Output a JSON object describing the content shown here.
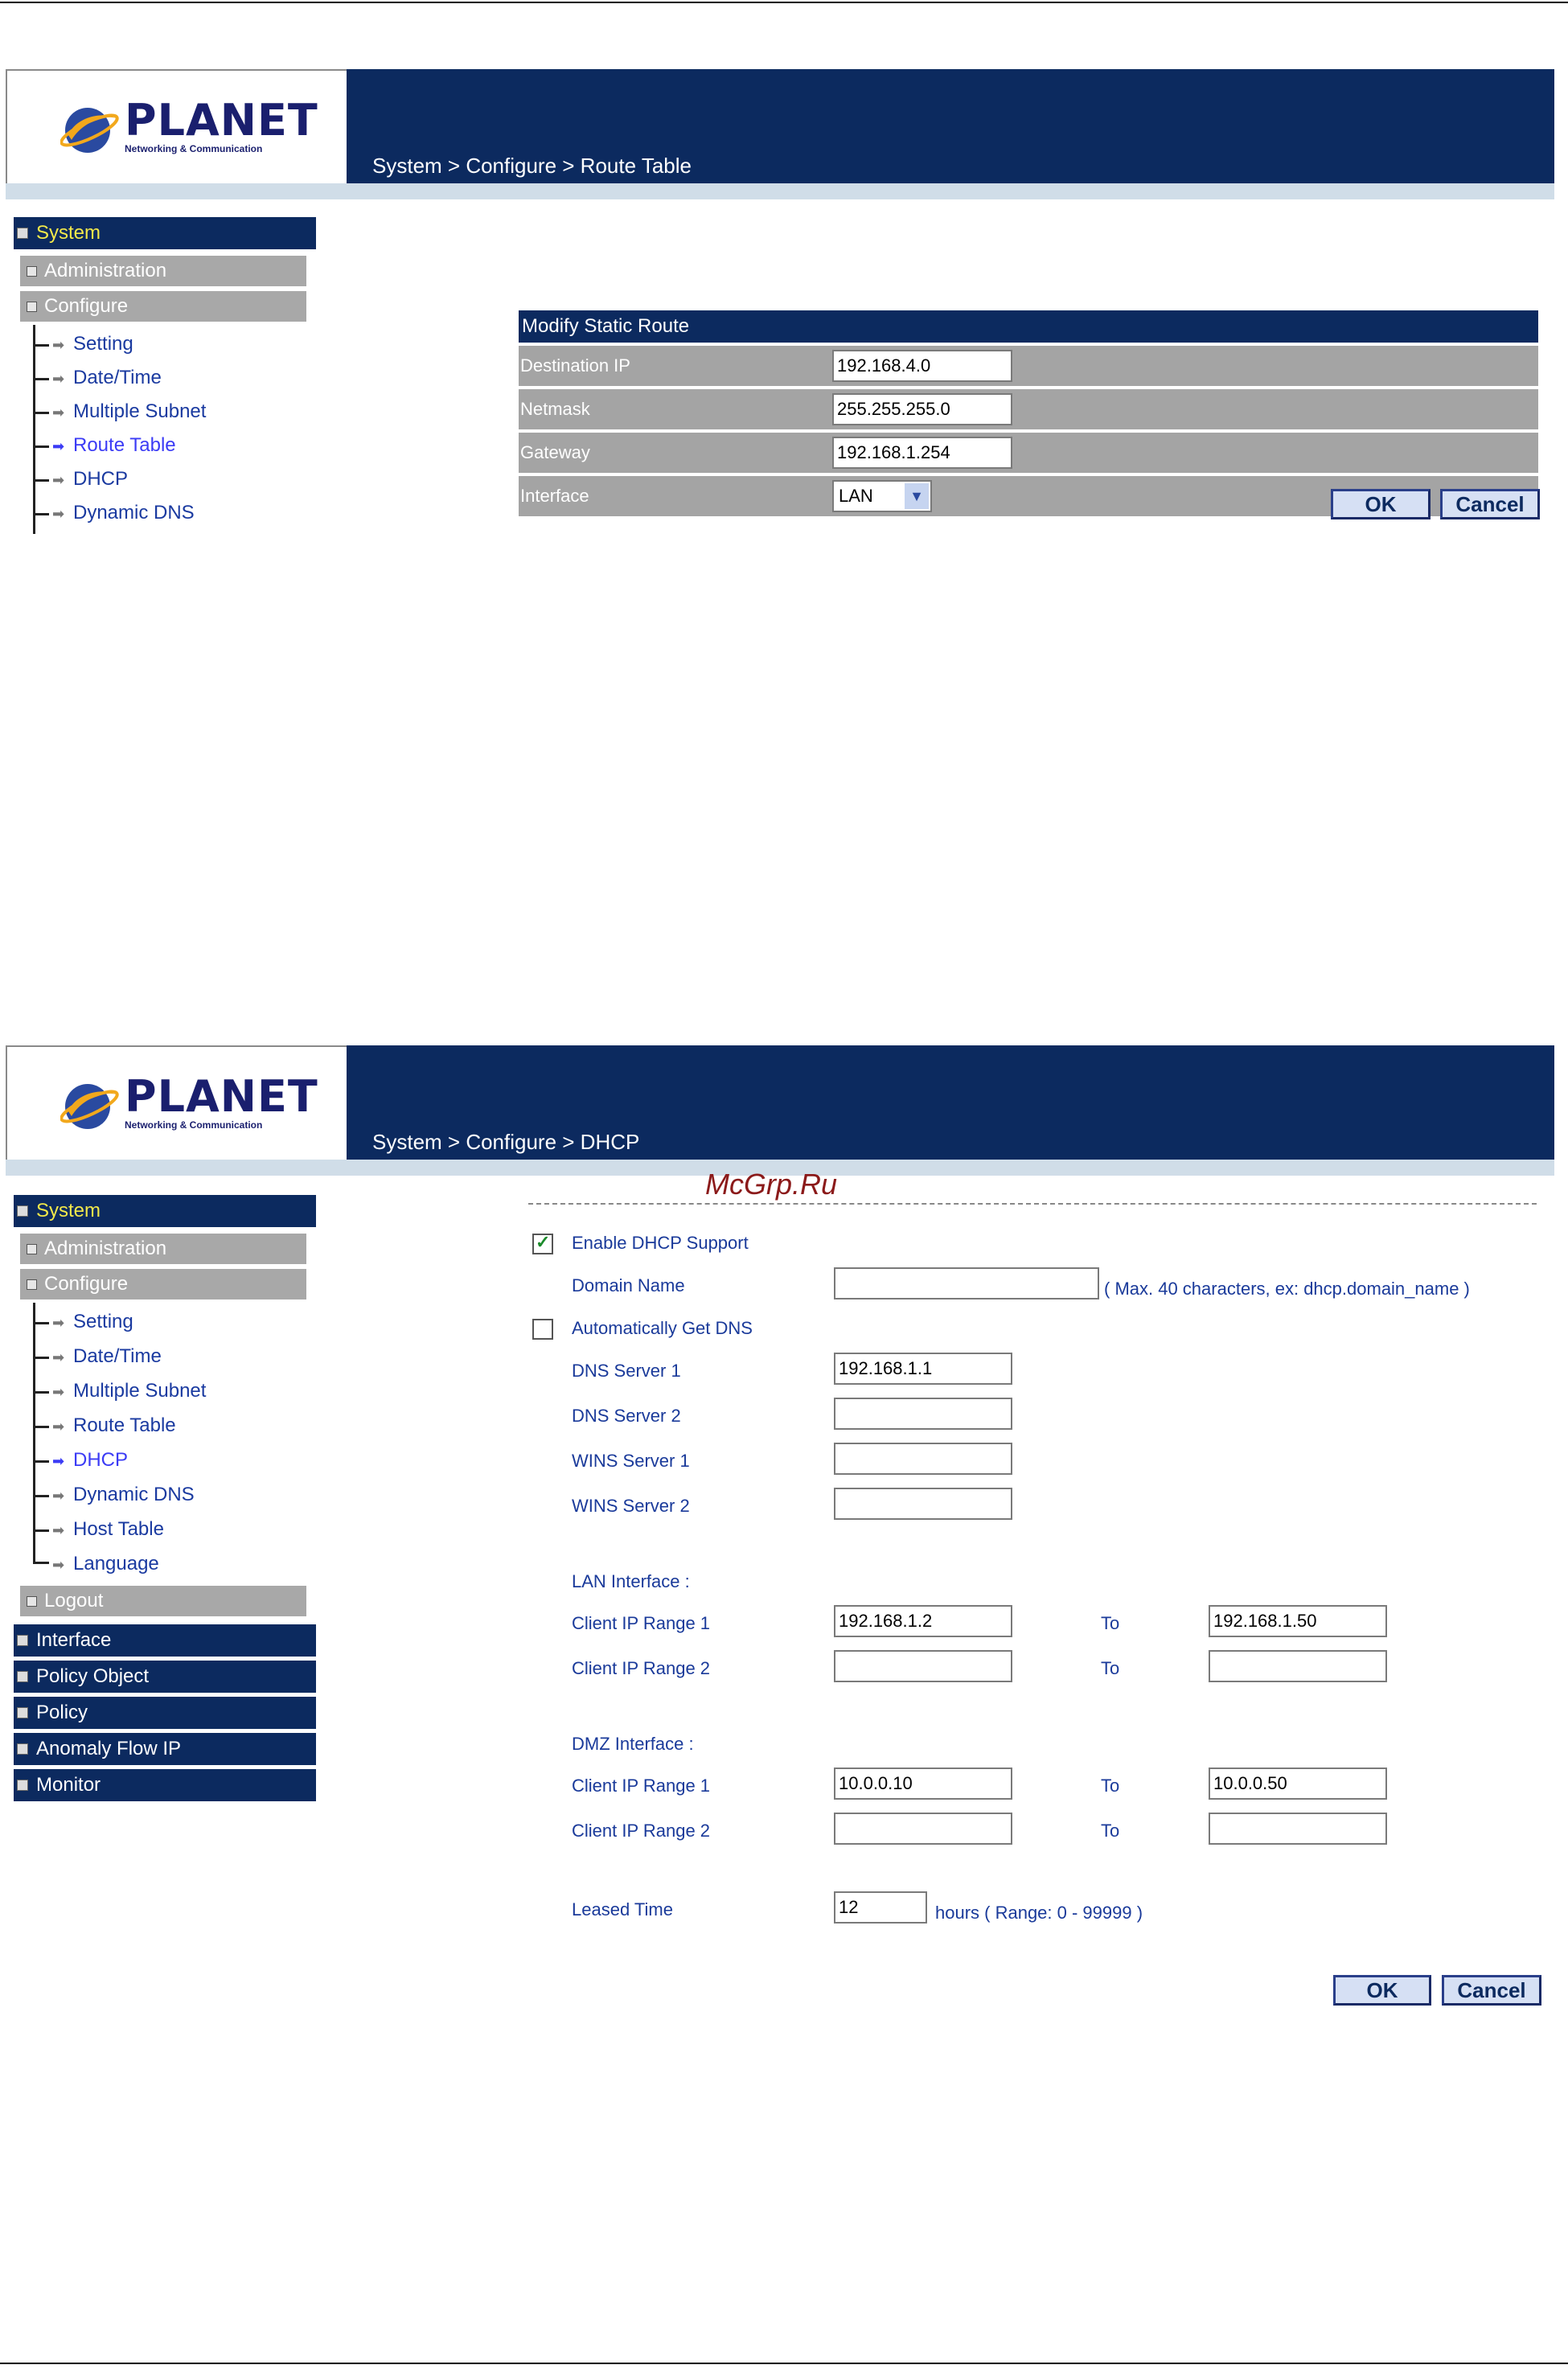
{
  "brand": {
    "name": "PLANET",
    "tagline": "Networking & Communication"
  },
  "screens": {
    "route": {
      "breadcrumb": "System > Configure > Route Table",
      "sidebar": {
        "root": "System",
        "administration": "Administration",
        "configure": "Configure",
        "items": [
          "Setting",
          "Date/Time",
          "Multiple Subnet",
          "Route Table",
          "DHCP",
          "Dynamic DNS"
        ]
      },
      "form": {
        "title": "Modify Static Route",
        "destination_label": "Destination IP",
        "destination_value": "192.168.4.0",
        "netmask_label": "Netmask",
        "netmask_value": "255.255.255.0",
        "gateway_label": "Gateway",
        "gateway_value": "192.168.1.254",
        "interface_label": "Interface",
        "interface_value": "LAN"
      },
      "ok": "OK",
      "cancel": "Cancel"
    },
    "dhcp": {
      "breadcrumb": "System > Configure > DHCP",
      "watermark": "McGrp.Ru",
      "sidebar": {
        "root": "System",
        "administration": "Administration",
        "configure": "Configure",
        "items": [
          "Setting",
          "Date/Time",
          "Multiple Subnet",
          "Route Table",
          "DHCP",
          "Dynamic DNS",
          "Host Table",
          "Language"
        ],
        "logout": "Logout",
        "sections": [
          "Interface",
          "Policy Object",
          "Policy",
          "Anomaly Flow IP",
          "Monitor"
        ]
      },
      "form": {
        "enable_label": "Enable DHCP Support",
        "enable_checked": true,
        "domain_label": "Domain Name",
        "domain_value": "",
        "domain_hint": "( Max. 40 characters, ex: dhcp.domain_name )",
        "auto_dns_label": "Automatically Get DNS",
        "auto_dns_checked": false,
        "dns1_label": "DNS Server 1",
        "dns1_value": "192.168.1.1",
        "dns2_label": "DNS Server 2",
        "dns2_value": "",
        "wins1_label": "WINS Server 1",
        "wins1_value": "",
        "wins2_label": "WINS Server 2",
        "wins2_value": "",
        "lan_heading": "LAN Interface :",
        "lan_range1_label": "Client IP Range 1",
        "lan_range1_from": "192.168.1.2",
        "lan_range1_to": "192.168.1.50",
        "lan_range2_label": "Client IP Range 2",
        "lan_range2_from": "",
        "lan_range2_to": "",
        "dmz_heading": "DMZ Interface :",
        "dmz_range1_label": "Client IP Range 1",
        "dmz_range1_from": "10.0.0.10",
        "dmz_range1_to": "10.0.0.50",
        "dmz_range2_label": "Client IP Range 2",
        "dmz_range2_from": "",
        "dmz_range2_to": "",
        "to_label": "To",
        "lease_label": "Leased Time",
        "lease_value": "12",
        "lease_hint": "hours  ( Range: 0 - 99999 )"
      },
      "ok": "OK",
      "cancel": "Cancel"
    }
  }
}
